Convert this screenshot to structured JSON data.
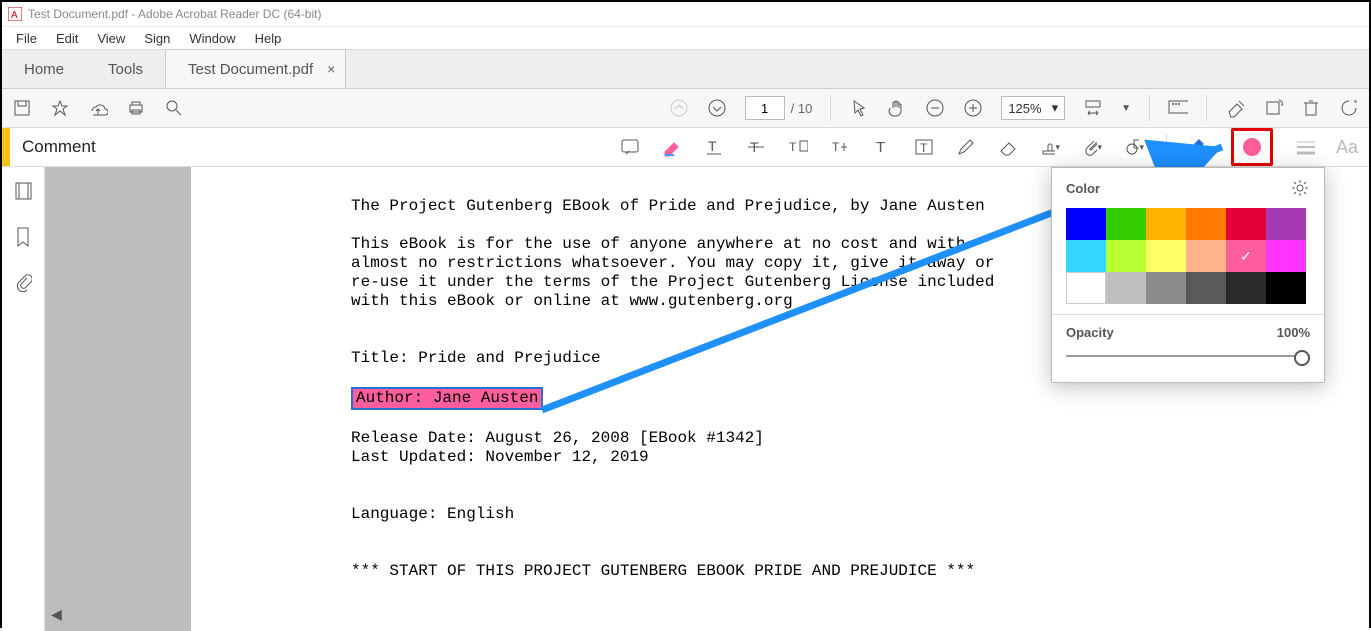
{
  "window_title": "Test Document.pdf - Adobe Acrobat Reader DC (64-bit)",
  "menu": [
    "File",
    "Edit",
    "View",
    "Sign",
    "Window",
    "Help"
  ],
  "tabs": {
    "home": "Home",
    "tools": "Tools",
    "doc": "Test Document.pdf"
  },
  "page": {
    "current": "1",
    "total": "10"
  },
  "zoom": "125%",
  "comment_label": "Comment",
  "color_panel": {
    "title": "Color",
    "opacity_label": "Opacity",
    "opacity_value": "100%",
    "colors": [
      "#0000ff",
      "#33cc00",
      "#ffb300",
      "#ff7a00",
      "#e6003a",
      "#a63ab5",
      "#33d6ff",
      "#b7ff33",
      "#ffff66",
      "#ffb38a",
      "#ff5e9c",
      "#ff33ff",
      "#ffffff",
      "#bfbfbf",
      "#8c8c8c",
      "#595959",
      "#2b2b2b",
      "#000000"
    ],
    "selected_index": 10
  },
  "doc_text": {
    "l1": "The Project Gutenberg EBook of Pride and Prejudice, by Jane Austen",
    "l2": "This eBook is for the use of anyone anywhere at no cost and with",
    "l3": "almost no restrictions whatsoever.  You may copy it, give it away or",
    "l4": "re-use it under the terms of the Project Gutenberg License included",
    "l5": "with this eBook or online at www.gutenberg.org",
    "title": "Title: Pride and Prejudice",
    "author": "Author: Jane Austen",
    "release": "Release Date: August 26, 2008 [EBook #1342]",
    "updated": "Last Updated: November 12, 2019",
    "lang": "Language: English",
    "start": "*** START OF THIS PROJECT GUTENBERG EBOOK PRIDE AND PREJUDICE ***"
  }
}
